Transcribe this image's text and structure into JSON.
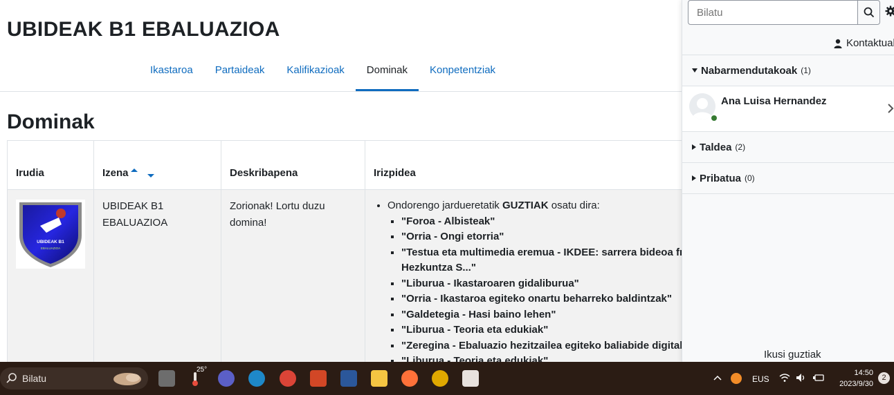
{
  "header": {
    "course_title": "UBIDEAK B1 EBALUAZIOA"
  },
  "nav": {
    "tabs": [
      {
        "label": "Ikastaroa",
        "active": false
      },
      {
        "label": "Partaideak",
        "active": false
      },
      {
        "label": "Kalifikazioak",
        "active": false
      },
      {
        "label": "Dominak",
        "active": true
      },
      {
        "label": "Konpetentziak",
        "active": false
      }
    ]
  },
  "page": {
    "heading": "Dominak"
  },
  "table": {
    "columns": [
      "Irudia",
      "Izena",
      "Deskribapena",
      "Irizpidea"
    ],
    "rows": [
      {
        "image_alt": "badge-shield",
        "badge_text_1": "UBIDEAK B1",
        "badge_text_2": "EBALUAZIOA",
        "name": "UBIDEAK B1 EBALUAZIOA",
        "description": "Zorionak! Lortu duzu domina!",
        "criteria_intro_1": "Ondorengo jardueretatik ",
        "criteria_intro_bold": "GUZTIAK",
        "criteria_intro_2": " osatu dira:",
        "criteria_items": [
          "\"Foroa - Albisteak\"",
          "\"Orria - Ongi etorria\"",
          "\"Testua eta multimedia eremua - IKDEE: sarrera bideoa fro",
          "Hezkuntza S...\"",
          "\"Liburua - Ikastaroaren gidaliburua\"",
          "\"Orria - Ikastaroa egiteko onartu beharreko baldintzak\"",
          "\"Galdetegia - Hasi baino lehen\"",
          "\"Liburua - Teoria eta edukiak\"",
          "\"Zeregina - Ebaluazio hezitzailea egiteko baliabide digitala",
          "\"Liburua - Teoria eta edukiak\""
        ]
      }
    ]
  },
  "drawer": {
    "search_placeholder": "Bilatu",
    "contacts_label": "Kontaktuak",
    "sections": [
      {
        "label": "Nabarmendutakoak",
        "count": "(1)",
        "expanded": true
      },
      {
        "label": "Taldea",
        "count": "(2)",
        "expanded": false
      },
      {
        "label": "Pribatua",
        "count": "(0)",
        "expanded": false
      }
    ],
    "contact": {
      "name": "Ana Luisa Hernandez",
      "online": true
    },
    "see_all": "Ikusi guztiak"
  },
  "taskbar": {
    "search_label": "Bilatu",
    "weather_temp": "25°",
    "language": "EUS",
    "time": "14:50",
    "date": "2023/9/30",
    "notifications": "2"
  },
  "colors": {
    "link": "#0f6cbf",
    "text": "#1d2125",
    "taskbar": "#2b1c14",
    "online": "#357a32"
  }
}
